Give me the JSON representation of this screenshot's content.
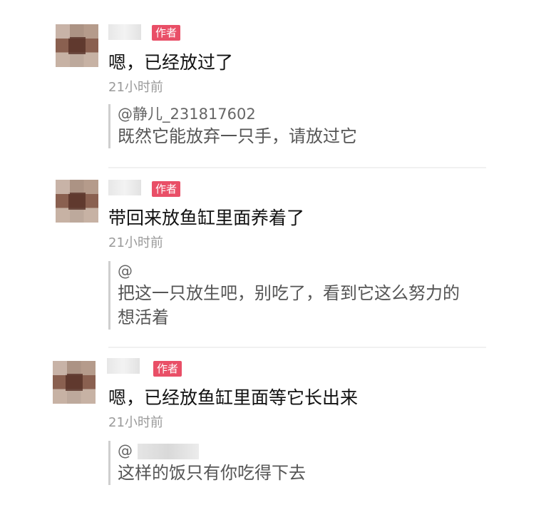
{
  "comments": [
    {
      "badge": "作者",
      "text": "嗯，已经放过了",
      "time": "21小时前",
      "quote_mention": "@静儿_231817602",
      "quote_text": "既然它能放弃一只手，请放过它"
    },
    {
      "badge": "作者",
      "text": "带回来放鱼缸里面养着了",
      "time": "21小时前",
      "quote_mention": "@",
      "quote_text": "把这一只放生吧，别吃了，看到它这么努力的想活着"
    },
    {
      "badge": "作者",
      "text": "嗯，已经放鱼缸里面等它长出来",
      "time": "21小时前",
      "quote_mention": "@",
      "quote_text": "这样的饭只有你吃得下去"
    }
  ]
}
